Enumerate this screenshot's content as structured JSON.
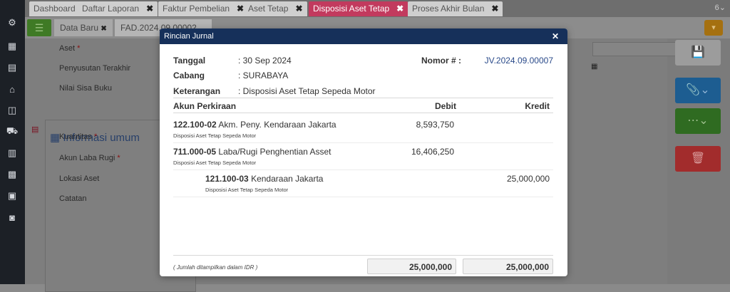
{
  "tabs": [
    {
      "label": "Dashboard",
      "close": ""
    },
    {
      "label": "Daftar Laporan",
      "close": "✖"
    },
    {
      "label": "Faktur Pembelian",
      "close": "✖"
    },
    {
      "label": "Aset Tetap",
      "close": "✖"
    },
    {
      "label": "Disposisi Aset Tetap",
      "close": "✖"
    },
    {
      "label": "Proses Akhir Bulan",
      "close": "✖"
    }
  ],
  "subtabs": {
    "new_label": "Data Baru",
    "new_close": "✖",
    "doc_label": "FAD.2024.09.00002",
    "doc_arrow": "⌄"
  },
  "form": {
    "aset": "Aset",
    "penyusutan": "Penyusutan Terakhir",
    "nilai_sisa": "Nilai Sisa Buku",
    "section": "Informasi umum",
    "kuantitas": "Kuantitas",
    "akun_laba": "Akun Laba Rugi",
    "lokasi": "Lokasi Aset",
    "catatan": "Catatan",
    "req": "*",
    "clear": "✖"
  },
  "modal": {
    "title": "Rincian Jurnal",
    "close": "✕",
    "tanggal_label": "Tanggal",
    "tanggal_value": ": 30 Sep 2024",
    "cabang_label": "Cabang",
    "cabang_value": ": SURABAYA",
    "keterangan_label": "Keterangan",
    "keterangan_value": ": Disposisi Aset Tetap Sepeda Motor",
    "nomor_label": "Nomor # :",
    "nomor_value": "JV.2024.09.00007",
    "col_akun": "Akun Perkiraan",
    "col_debit": "Debit",
    "col_kredit": "Kredit",
    "rows": [
      {
        "code": "122.100-02",
        "name": " Akm. Peny. Kendaraan Jakarta",
        "note": "Disposisi Aset Tetap Sepeda Motor",
        "debit": "8,593,750",
        "kredit": ""
      },
      {
        "code": "711.000-05",
        "name": " Laba/Rugi Penghentian Asset",
        "note": "Disposisi Aset Tetap Sepeda Motor",
        "debit": "16,406,250",
        "kredit": ""
      },
      {
        "code": "121.100-03",
        "name": " Kendaraan Jakarta",
        "note": "Disposisi Aset Tetap Sepeda Motor",
        "debit": "",
        "kredit": "25,000,000"
      }
    ],
    "footnote": "( Jumlah ditampilkan dalam IDR )",
    "total_debit": "25,000,000",
    "total_kredit": "25,000,000"
  },
  "colors": {
    "header": "#16305a",
    "active_tab": "#c23a5e",
    "rail": "#1c2026"
  }
}
